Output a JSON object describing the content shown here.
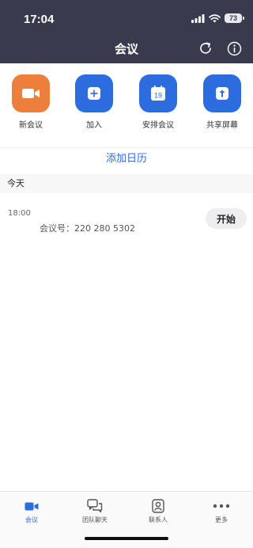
{
  "status": {
    "time": "17:04",
    "battery": "73"
  },
  "header": {
    "title": "会议",
    "refresh_icon": "refresh-icon",
    "info_icon": "info-icon"
  },
  "quick_actions": [
    {
      "label": "新会议",
      "icon": "video-camera-icon",
      "color": "#ee7e3c"
    },
    {
      "label": "加入",
      "icon": "plus-icon",
      "color": "#2d6cdf"
    },
    {
      "label": "安排会议",
      "icon": "calendar-icon",
      "calendar_day": "19",
      "color": "#2d6cdf"
    },
    {
      "label": "共享屏幕",
      "icon": "share-screen-icon",
      "color": "#2d6cdf"
    }
  ],
  "add_calendar": "添加日历",
  "section": {
    "today": "今天"
  },
  "meeting": {
    "time": "18:00",
    "id_text": "会议号：220 280 5302",
    "start_label": "开始"
  },
  "tabs": [
    {
      "label": "会议",
      "icon": "video-camera-icon",
      "active": true
    },
    {
      "label": "团队聊天",
      "icon": "chat-bubbles-icon",
      "active": false
    },
    {
      "label": "联系人",
      "icon": "contact-icon",
      "active": false
    },
    {
      "label": "更多",
      "icon": "more-dots-icon",
      "active": false
    }
  ],
  "colors": {
    "header_bg": "#3a3a4e",
    "accent": "#2d6cdf",
    "orange": "#ee7e3c"
  }
}
